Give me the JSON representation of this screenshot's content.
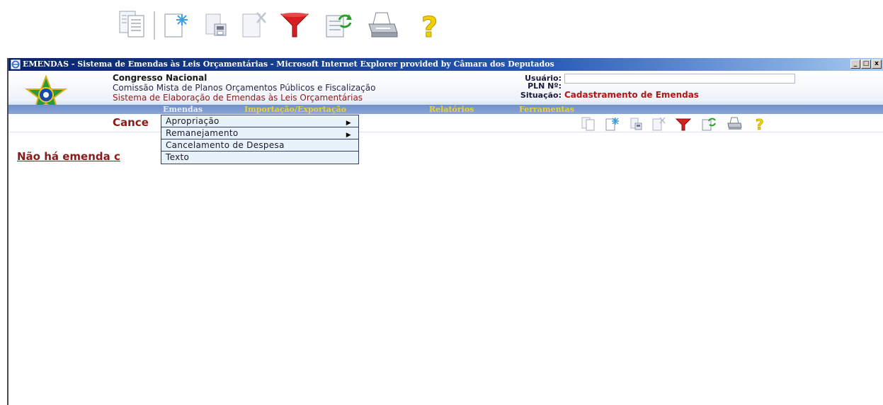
{
  "window": {
    "title": "EMENDAS - Sistema de Emendas às Leis Orçamentárias - Microsoft Internet Explorer provided by Câmara dos Deputados",
    "buttons": {
      "minimize": "_",
      "maximize": "□",
      "close": "x"
    }
  },
  "header": {
    "org_line1": "Congresso Nacional",
    "org_line2": "Comissão Mista de Planos Orçamentos Públicos e Fiscalização",
    "org_line3": "Sistema de Elaboração de Emendas às Leis Orçamentárias",
    "user_label": "Usuário:",
    "user_value": "",
    "pln_label": "PLN Nº:",
    "pln_value": "",
    "status_label": "Situação:",
    "status_value": "Cadastramento de Emendas"
  },
  "menu": {
    "items": [
      {
        "label": "Emendas"
      },
      {
        "label": "Importação/Exportação"
      },
      {
        "label": "Relatórios"
      },
      {
        "label": "Ferramentas"
      }
    ]
  },
  "dropdown": {
    "items": [
      {
        "label": "Apropriação",
        "has_submenu": true
      },
      {
        "label": "Remanejamento",
        "has_submenu": true
      },
      {
        "label": "Cancelamento de Despesa",
        "has_submenu": false
      },
      {
        "label": "Texto",
        "has_submenu": false
      }
    ]
  },
  "page": {
    "title": "Cance",
    "empty_message": "Não há emenda c"
  },
  "toolbar_icons": [
    "document-icon",
    "new-document-icon",
    "save-icon",
    "delete-icon",
    "filter-icon",
    "refresh-icon",
    "print-icon",
    "help-icon"
  ],
  "colors": {
    "accent_red": "#8b1a1a",
    "menu_yellow": "#e8d23a",
    "title_blue": "#0a246a",
    "filter_red": "#d42020",
    "help_yellow": "#f0d000"
  }
}
